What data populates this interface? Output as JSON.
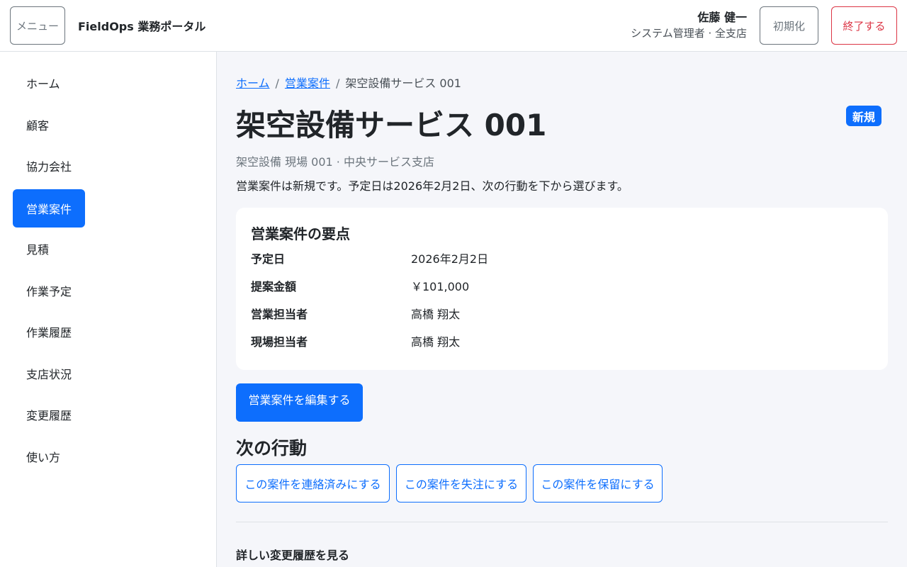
{
  "header": {
    "menu_label": "メニュー",
    "app_title": "FieldOps 業務ポータル",
    "user_name": "佐藤 健一",
    "user_role": "システム管理者 · 全支店",
    "reset_label": "初期化",
    "exit_label": "終了する"
  },
  "sidebar": {
    "items": [
      {
        "label": "ホーム",
        "active": false
      },
      {
        "label": "顧客",
        "active": false
      },
      {
        "label": "協力会社",
        "active": false
      },
      {
        "label": "営業案件",
        "active": true
      },
      {
        "label": "見積",
        "active": false
      },
      {
        "label": "作業予定",
        "active": false
      },
      {
        "label": "作業履歴",
        "active": false
      },
      {
        "label": "支店状況",
        "active": false
      },
      {
        "label": "変更履歴",
        "active": false
      },
      {
        "label": "使い方",
        "active": false
      }
    ]
  },
  "breadcrumb": {
    "home": "ホーム",
    "section": "営業案件",
    "current": "架空設備サービス 001",
    "separator": "/"
  },
  "page": {
    "title": "架空設備サービス 001",
    "status_badge": "新規",
    "subtitle": "架空設備 現場 001 · 中央サービス支店",
    "summary": "営業案件は新規です。予定日は2026年2月2日、次の行動を下から選びます。"
  },
  "card": {
    "title": "営業案件の要点",
    "rows": [
      {
        "label": "予定日",
        "value": "2026年2月2日"
      },
      {
        "label": "提案金額",
        "value": "￥101,000"
      },
      {
        "label": "営業担当者",
        "value": "高橋 翔太"
      },
      {
        "label": "現場担当者",
        "value": "高橋 翔太"
      }
    ]
  },
  "actions": {
    "edit_label": "営業案件を編集する",
    "next_title": "次の行動",
    "buttons": [
      {
        "label": "この案件を連絡済みにする"
      },
      {
        "label": "この案件を失注にする"
      },
      {
        "label": "この案件を保留にする"
      }
    ],
    "history_link": "詳しい変更履歴を見る"
  },
  "colors": {
    "primary": "#0d6efd",
    "danger": "#dc3545",
    "secondary": "#6c757d",
    "background": "#f5f6fa"
  }
}
